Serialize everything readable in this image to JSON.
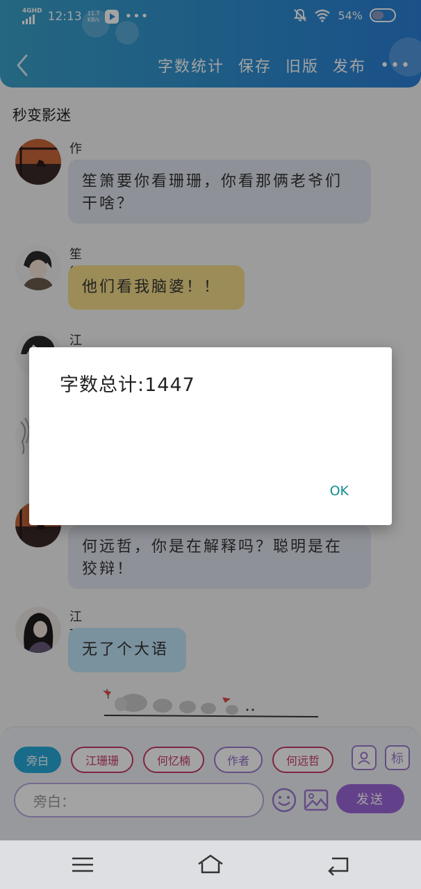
{
  "status_bar": {
    "network": "4GHD",
    "time": "12:13",
    "speed_value": "11.7",
    "speed_unit": "KB/s",
    "battery": "54%",
    "battery_level": 0.54
  },
  "toolbar": {
    "word_count": "字数统计",
    "save": "保存",
    "old_version": "旧版",
    "publish": "发布"
  },
  "story": {
    "title": "秒变影迷"
  },
  "messages": [
    {
      "name": "作者",
      "text": "笙箫要你看珊珊，你看那俩老爷们干啥？",
      "bubble_color": "#dfe3ec"
    },
    {
      "name": "笙箫",
      "text": "他们看我脑婆！！",
      "bubble_color": "#f2dc8a"
    },
    {
      "name": "江琐宇",
      "text": "",
      "bubble_color": "#dfe3ec"
    },
    {
      "name": "",
      "text": "何远哲，你是在解释吗？聪明是在狡辩！",
      "bubble_color": "#dfe3ec"
    },
    {
      "name": "江珊珊",
      "text": "无了个大语",
      "bubble_color": "#bfe3f7"
    }
  ],
  "characters": [
    {
      "label": "旁白",
      "active": true
    },
    {
      "label": "江珊珊",
      "active": false
    },
    {
      "label": "何忆楠",
      "active": false
    },
    {
      "label": "作者",
      "active": false
    },
    {
      "label": "何远哲",
      "active": false
    }
  ],
  "tools": {
    "mark_label": "标"
  },
  "input": {
    "placeholder": "旁白："
  },
  "send_label": "发送",
  "dialog": {
    "message": "字数总计:1447",
    "ok_label": "OK"
  },
  "colors": {
    "header_start": "#3aa0c8",
    "header_end": "#2a7fd6",
    "accent_purple": "#9b66d8",
    "chip_red": "#c53b6a",
    "dialog_ok": "#138f8f"
  }
}
